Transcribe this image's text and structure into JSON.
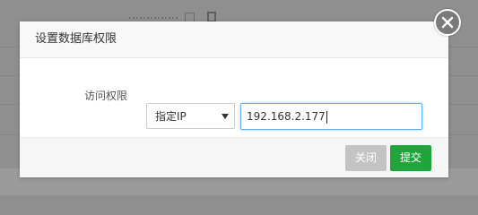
{
  "dialog": {
    "title": "设置数据库权限",
    "access_label": "访问权限",
    "select_value": "指定IP",
    "ip_value": "192.168.2.177",
    "close_label": "关闭",
    "submit_label": "提交"
  },
  "icons": {
    "close": "close-icon",
    "dropdown": "chevron-down-icon"
  },
  "colors": {
    "submit": "#20a53a",
    "close_button": "#c4c4c4",
    "input_focus": "#66afe9"
  }
}
